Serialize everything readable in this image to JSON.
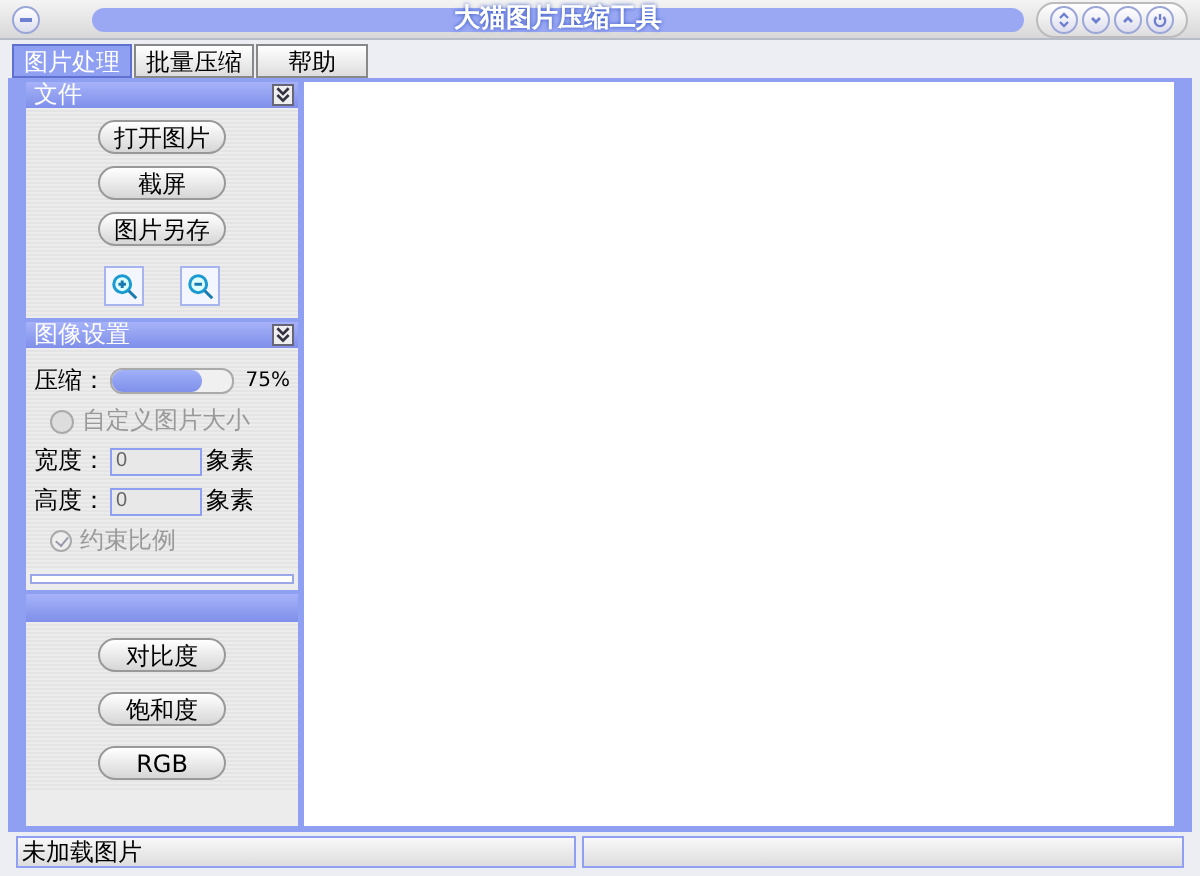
{
  "window": {
    "title": "大猫图片压缩工具"
  },
  "tabs": [
    {
      "label": "图片处理",
      "selected": true
    },
    {
      "label": "批量压缩",
      "selected": false
    },
    {
      "label": "帮助",
      "selected": false
    }
  ],
  "file_panel": {
    "title": "文件",
    "buttons": [
      "打开图片",
      "截屏",
      "图片另存"
    ]
  },
  "settings_panel": {
    "title": "图像设置",
    "compression": {
      "label": "压缩：",
      "level": 0.75,
      "reading": "75%"
    },
    "custom_size": {
      "label": "自定义图片大小",
      "selected": false,
      "disabled": true
    },
    "fields": [
      {
        "label": "宽度：",
        "value": "0",
        "unit": "象素",
        "disabled": true
      },
      {
        "label": "高度：",
        "value": "0",
        "unit": "象素",
        "disabled": true
      }
    ],
    "constrain": {
      "label": "约束比例",
      "checked": true,
      "disabled": true
    }
  },
  "adjust_panel": {
    "buttons": [
      "对比度",
      "饱和度",
      "RGB"
    ]
  },
  "status_bar": [
    "未加载图片"
  ]
}
